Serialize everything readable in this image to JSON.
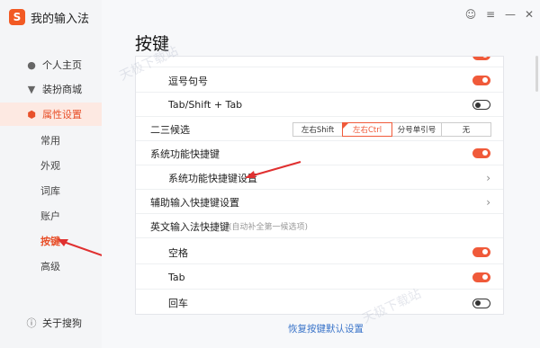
{
  "app": {
    "title": "我的输入法",
    "logo_text": "S"
  },
  "window_buttons": [
    {
      "name": "feedback-icon",
      "glyph": "☺"
    },
    {
      "name": "menu-icon",
      "glyph": "≡"
    },
    {
      "name": "minimize-icon",
      "glyph": "—"
    },
    {
      "name": "close-icon",
      "glyph": "✕"
    }
  ],
  "sidebar": {
    "items": [
      {
        "label": "个人主页",
        "icon": "user-icon",
        "glyph": "👤"
      },
      {
        "label": "装扮商城",
        "icon": "shirt-icon",
        "glyph": "👕"
      },
      {
        "label": "属性设置",
        "icon": "gear-icon",
        "glyph": "⬢",
        "active": true
      }
    ],
    "sub_items": [
      {
        "label": "常用"
      },
      {
        "label": "外观"
      },
      {
        "label": "词库"
      },
      {
        "label": "账户"
      },
      {
        "label": "按键",
        "active": true
      },
      {
        "label": "高级"
      }
    ],
    "about": {
      "label": "关于搜狗",
      "icon": "info-icon",
      "glyph": "ℹ"
    }
  },
  "main": {
    "title": "按键",
    "rows": [
      {
        "label": "逗号句号",
        "control": "toggle",
        "state": "on",
        "sub": true
      },
      {
        "label": "Tab/Shift + Tab",
        "control": "toggle",
        "state": "off",
        "sub": true
      },
      {
        "label": "二三候选",
        "control": "segmented",
        "options": [
          "左右Shift",
          "左右Ctrl",
          "分号单引号",
          "无"
        ],
        "selected": "左右Ctrl"
      },
      {
        "label": "系统功能快捷键",
        "control": "toggle",
        "state": "on"
      },
      {
        "label": "系统功能快捷键设置",
        "control": "chevron",
        "sub": true
      },
      {
        "label": "辅助输入快捷键设置",
        "control": "chevron"
      },
      {
        "label": "英文输入法快捷键",
        "hint": "(自动补全第一候选项)",
        "control": "none"
      },
      {
        "label": "空格",
        "control": "toggle",
        "state": "on",
        "sub": true
      },
      {
        "label": "Tab",
        "control": "toggle",
        "state": "on",
        "sub": true
      },
      {
        "label": "回车",
        "control": "toggle",
        "state": "off",
        "sub": true
      }
    ],
    "restore_link": "恢复按键默认设置"
  },
  "watermarks": [
    "天极下载站",
    "天极下载站"
  ],
  "colors": {
    "accent": "#f05a3a",
    "active_bg": "#fde9e2",
    "link": "#3a74c9"
  }
}
